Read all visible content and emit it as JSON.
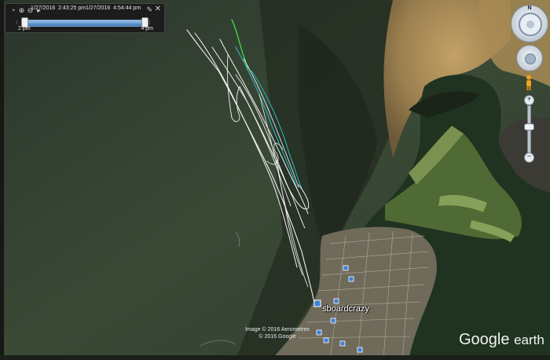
{
  "time_slider": {
    "start_date": "1/27/2016",
    "start_time": "2:43:25 pm",
    "end_date": "1/27/2016",
    "end_time": "4:54:44 pm",
    "start_label": "2 pm",
    "end_label": "4 pm",
    "icons": [
      "clock-icon",
      "zoom-in-icon",
      "zoom-out-icon",
      "settings-icon",
      "close-icon"
    ]
  },
  "placemark": {
    "label": "sboardcrazy"
  },
  "imagery_credit": {
    "line1": "Image © 2016 Aerometrex",
    "line2": "© 2016 Google"
  },
  "logo": {
    "brand": "Google",
    "product": "earth"
  },
  "nav": {
    "north_label": "N",
    "zoom_in": "+",
    "zoom_out": "−"
  },
  "colors": {
    "water": "#354532",
    "track_primary": "#f2f2f2",
    "track_start": "#3fd34a",
    "track_secondary": "#2ab0b6",
    "sand": "#b89a5e"
  }
}
